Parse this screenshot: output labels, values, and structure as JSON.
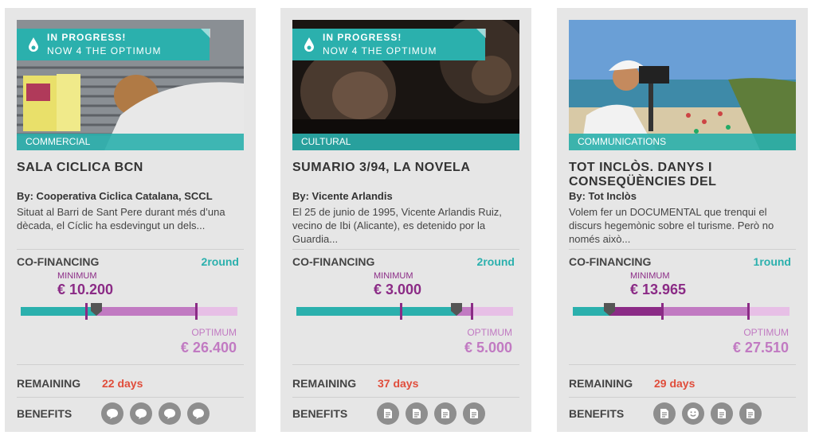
{
  "cards": [
    {
      "status": "IN PROGRESS!",
      "substatus": "NOW 4 THE OPTIMUM",
      "category": "COMMERCIAL",
      "title": "SALA CICLICA BCN",
      "author": "By: Cooperativa Ciclica Catalana, SCCL",
      "description": "Situat al Barri de Sant Pere durant més d’una dècada, el Cíclic ha esdevingut un dels...",
      "cofinancing_label": "CO-FINANCING",
      "round": "2round",
      "minimum_label": "MINIMUM",
      "minimum": "€ 10.200",
      "optimum_label": "OPTIMUM",
      "optimum": "€ 26.400",
      "progress": {
        "funded_fraction": 0.35,
        "minimum_fraction": 0.3,
        "optimum_fraction": 0.81
      },
      "remaining_label": "REMAINING",
      "remaining": "22 days",
      "benefits_label": "BENEFITS",
      "benefit_icons": [
        "speech-bubble-icon",
        "speech-bubble-icon",
        "speech-bubble-icon",
        "speech-bubble-icon"
      ]
    },
    {
      "status": "IN PROGRESS!",
      "substatus": "NOW 4 THE OPTIMUM",
      "category": "CULTURAL",
      "title": "SUMARIO 3/94, LA NOVELA",
      "author": "By: Vicente Arlandis",
      "description": "El 25 de junio de 1995, Vicente Arlandis Ruiz, vecino de Ibi (Alicante), es detenido por la Guardia...",
      "cofinancing_label": "CO-FINANCING",
      "round": "2round",
      "minimum_label": "MINIMUM",
      "minimum": "€ 3.000",
      "optimum_label": "OPTIMUM",
      "optimum": "€ 5.000",
      "progress": {
        "funded_fraction": 0.74,
        "minimum_fraction": 0.48,
        "optimum_fraction": 0.81
      },
      "remaining_label": "REMAINING",
      "remaining": "37 days",
      "benefits_label": "BENEFITS",
      "benefit_icons": [
        "file-icon",
        "file-icon",
        "file-icon",
        "file-icon"
      ]
    },
    {
      "status": "",
      "substatus": "",
      "category": "COMMUNICATIONS",
      "title": "TOT INCLÒS. DANYS I CONSEQÜÈNCIES DEL",
      "author": "By: Tot Inclòs",
      "description": "Volem fer un DOCUMENTAL que trenqui el discurs hegemònic sobre el turisme. Però no només això...",
      "cofinancing_label": "CO-FINANCING",
      "round": "1round",
      "minimum_label": "MINIMUM",
      "minimum": "€ 13.965",
      "optimum_label": "OPTIMUM",
      "optimum": "€ 27.510",
      "progress": {
        "funded_fraction": 0.17,
        "minimum_fraction": 0.41,
        "optimum_fraction": 0.81
      },
      "remaining_label": "REMAINING",
      "remaining": "29 days",
      "benefits_label": "BENEFITS",
      "benefit_icons": [
        "file-icon",
        "smiley-icon",
        "file-icon",
        "file-icon"
      ]
    }
  ],
  "colors": {
    "teal": "#2bb0ad",
    "purple": "#8b2b86",
    "light_purple": "#c17ac2",
    "red": "#e04d3b",
    "card_bg": "#e6e6e6"
  }
}
